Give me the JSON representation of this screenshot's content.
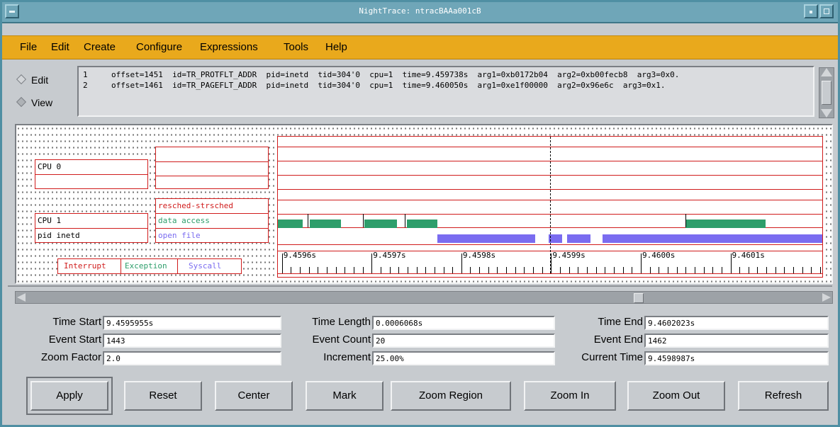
{
  "window": {
    "title": "NightTrace: ntracBAAa001cB"
  },
  "menu": [
    "File",
    "Edit",
    "Create",
    "Configure",
    "Expressions",
    "Tools",
    "Help"
  ],
  "mode": {
    "edit_label": "Edit",
    "view_label": "View",
    "selected": "View"
  },
  "events": [
    {
      "index": "1",
      "text": "offset=1451  id=TR_PROTFLT_ADDR  pid=inetd  tid=304'0  cpu=1  time=9.459738s  arg1=0xb0172b04  arg2=0xb00fecb8  arg3=0x0."
    },
    {
      "index": "2",
      "text": "offset=1461  id=TR_PAGEFLT_ADDR  pid=inetd  tid=304'0  cpu=1  time=9.460050s  arg1=0xe1f00000  arg2=0x96e6c  arg3=0x1."
    }
  ],
  "display": {
    "cpu0_label": "CPU 0",
    "cpu1_label": "CPU 1",
    "pid_label": "pid inetd",
    "rows": {
      "resched": "resched-strsched",
      "data": "data access",
      "open": "open file"
    },
    "legend": {
      "interrupt": "Interrupt",
      "exception": "Exception",
      "syscall": "Syscall"
    },
    "colors": {
      "grid": "#d01c1c",
      "exception": "#2e9e6b",
      "syscall": "#7a6cf0",
      "interrupt": "#d01c1c"
    },
    "time_axis": {
      "labels": [
        "9.4596s",
        "9.4597s",
        "9.4598s",
        "9.4599s",
        "9.4600s",
        "9.4601s"
      ],
      "start": 9.4595955,
      "end": 9.4602023,
      "current": 9.4598987
    },
    "data_access_segments": [
      [
        9.4595955,
        9.459623
      ],
      [
        9.459631,
        9.459666
      ],
      [
        9.459692,
        9.459728
      ],
      [
        9.459739,
        9.459773
      ],
      [
        9.46005,
        9.460139
      ]
    ],
    "markers": [
      9.459629,
      9.45969,
      9.459737,
      9.46005
    ],
    "open_file_segments": [
      [
        9.459773,
        9.459882
      ],
      [
        9.459897,
        9.459912
      ],
      [
        9.459918,
        9.459944
      ],
      [
        9.459957,
        9.4602023
      ]
    ]
  },
  "fields": {
    "time_start_label": "Time Start",
    "time_start": "9.4595955s",
    "event_start_label": "Event Start",
    "event_start": "1443",
    "zoom_factor_label": "Zoom Factor",
    "zoom_factor": "2.0",
    "time_length_label": "Time Length",
    "time_length": "0.0006068s",
    "event_count_label": "Event Count",
    "event_count": "20",
    "increment_label": "Increment",
    "increment": "25.00%",
    "time_end_label": "Time End",
    "time_end": "9.4602023s",
    "event_end_label": "Event End",
    "event_end": "1462",
    "current_time_label": "Current Time",
    "current_time": "9.4598987s"
  },
  "buttons": {
    "apply": "Apply",
    "reset": "Reset",
    "center": "Center",
    "mark": "Mark",
    "zoom_region": "Zoom Region",
    "zoom_in": "Zoom In",
    "zoom_out": "Zoom Out",
    "refresh": "Refresh"
  }
}
